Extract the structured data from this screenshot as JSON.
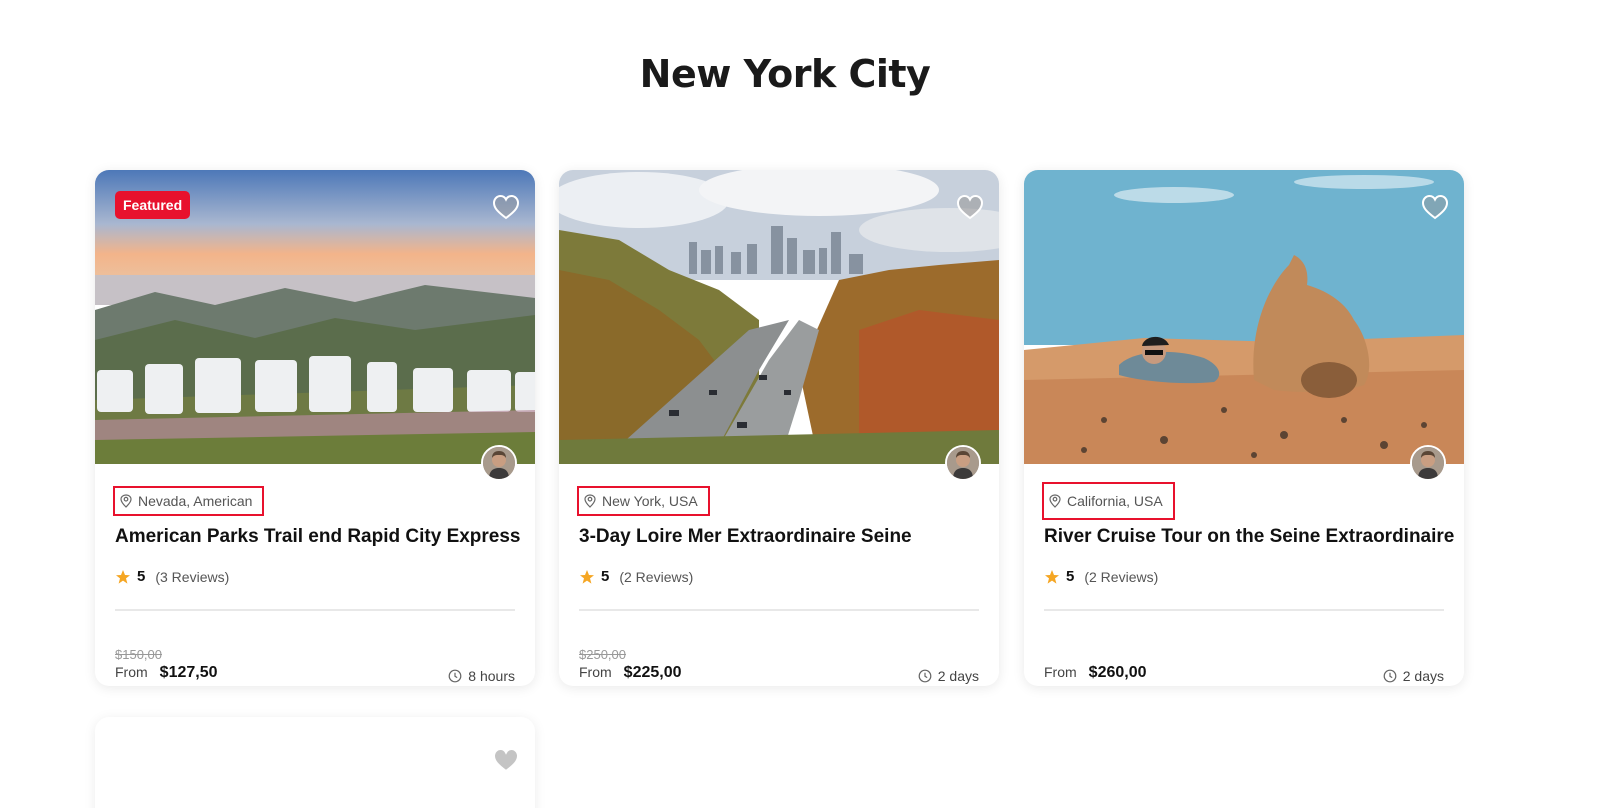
{
  "page": {
    "title": "New York City"
  },
  "colors": {
    "accent": "#e8112d",
    "star": "#f5a623",
    "text": "#111111"
  },
  "cards": [
    {
      "badge": "Featured",
      "location": "Nevada, American",
      "title": "American Parks Trail end Rapid City Express",
      "rating": "5",
      "reviews": "(3 Reviews)",
      "old_price": "$150,00",
      "from": "From",
      "price": "$127,50",
      "duration": "8 hours",
      "icons": {
        "favorite": "heart-icon",
        "location": "map-pin-icon",
        "rating": "star-icon",
        "duration": "clock-icon"
      }
    },
    {
      "location": "New York, USA",
      "title": "3-Day Loire Mer Extraordinaire Seine",
      "rating": "5",
      "reviews": "(2 Reviews)",
      "old_price": "$250,00",
      "from": "From",
      "price": "$225,00",
      "duration": "2 days"
    },
    {
      "location": "California, USA",
      "title": "River Cruise Tour on the Seine Extraordinaire",
      "rating": "5",
      "reviews": "(2 Reviews)",
      "from": "From",
      "price": "$260,00",
      "duration": "2 days"
    }
  ]
}
